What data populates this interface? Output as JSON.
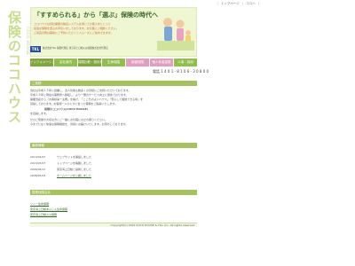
{
  "sidebar": {
    "logo_text": "保険のココハウス",
    "logo_sub": "COCO HOUSE"
  },
  "topnav": {
    "items": [
      "トップページ",
      "ココハ"
    ]
  },
  "header": {
    "title": "「すすめられる」から「選ぶ」保険の時代へ",
    "lines": [
      "ココハウスは自社開発の独自システムを通じてお客さまにとって",
      "最適な保険を選ぶお手伝いをしております。お気軽にご相談ください。",
      "ご来店の際は事前にご予約いただくとスムーズにご案内できます。"
    ],
    "tkl_label": "TKL",
    "tkl_text": "株式会社TKL 保険代理店 東京海上日動火災保険株式会社代理店"
  },
  "menu": {
    "items": [
      "インフォメーション",
      "会社案内",
      "保険比較・設計相談",
      "生命保険",
      "損害保険",
      "個人年金保険",
      "人事・採用"
    ]
  },
  "contact": {
    "phone": "電話 1 4 0 1 - 8 1 0 6 - 3 0 8 0 0"
  },
  "greeting": {
    "heading": "ご挨拶",
    "lines": [
      "当社は平成１３年に創業し、法人化後も数多くの皆様にご支持いただいております。",
      "平成１９年に現在の事務所へ移転し、より一層のサービス向上に努めております。",
      "開業当初から「お客様第一主義」を掲げ、「ここちのよいハウス」「安心して相談できる場」を",
      "目指しております。お客様一人ひとりに合った保険をご提案いたします。",
      "保険のココハウス(COCO HOUSE)",
      "を目指します。",
      "ぜひご家族や大切な方とご一緒にお気軽にお立ち寄りください。",
      "今までになく快適な保険相談を、皆様にお届けいたします。お待ちしております。"
    ]
  },
  "news": {
    "heading": "最新情報",
    "items": [
      {
        "date": "2014/02/07",
        "text": "ウェブサイトを開設しました"
      },
      {
        "date": "2013/05/07",
        "text": "トップページを掲載しました"
      },
      {
        "date": "2009/06/11",
        "text": "東京海上日動と提携しました"
      },
      {
        "date": "2008/05/03",
        "text": "ホームページを公開しました"
      }
    ]
  },
  "links": {
    "heading": "提携保険会社",
    "items": [
      "ソニー生命保険",
      "東京海上日動あんしん生命保険",
      "東京海上日動火災保険"
    ]
  },
  "footer": {
    "copyright": "Copyright(C) 2009 COCO HOUSE & TKL. Inc. All rights reserved."
  }
}
